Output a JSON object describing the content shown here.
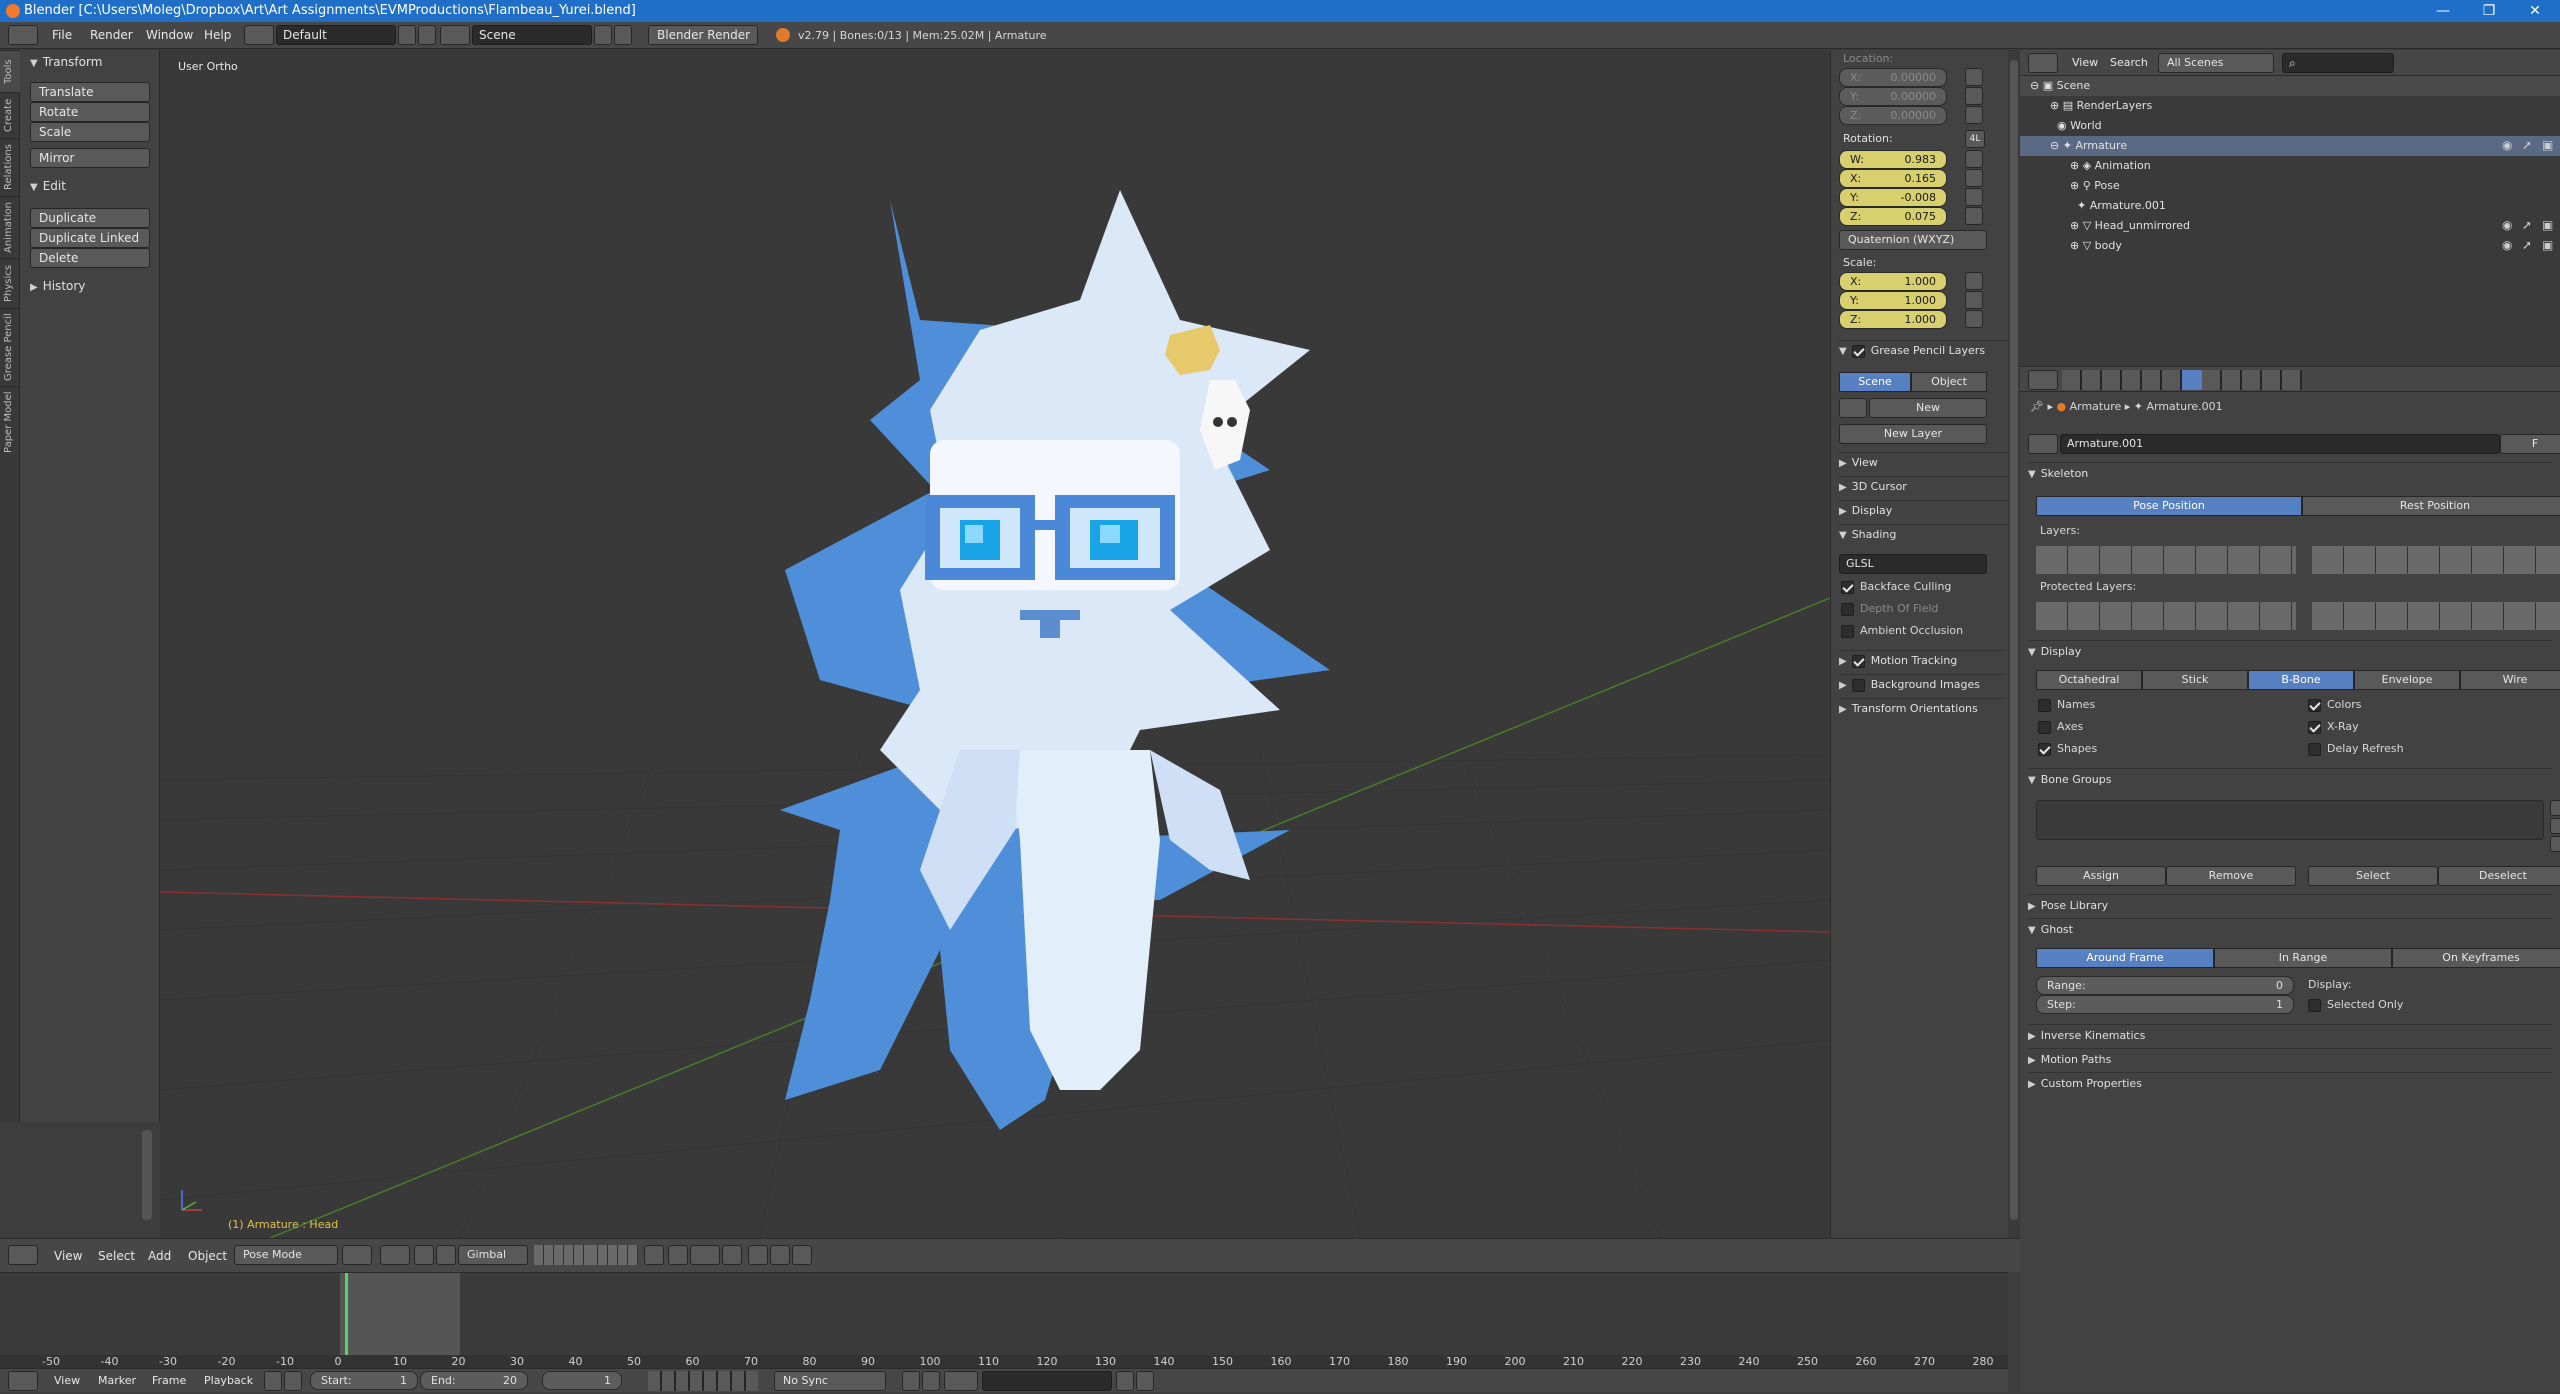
{
  "window": {
    "title": "Blender [C:\\Users\\Moleg\\Dropbox\\Art\\Art Assignments\\EVMProductions\\Flambeau_Yurei.blend]",
    "controls": [
      "—",
      "❐",
      "✕"
    ]
  },
  "infobar": {
    "menus": [
      "File",
      "Render",
      "Window",
      "Help"
    ],
    "layout": "Default",
    "scene": "Scene",
    "engine": "Blender Render",
    "stats": "v2.79 | Bones:0/13 | Mem:25.02M | Armature"
  },
  "toolshelf": {
    "tabs": [
      "Tools",
      "Create",
      "Relations",
      "Animation",
      "Physics",
      "Grease Pencil",
      "Paper Model"
    ],
    "transform_title": "Transform",
    "transform": [
      "Translate",
      "Rotate",
      "Scale"
    ],
    "mirror": "Mirror",
    "edit_title": "Edit",
    "edit": [
      "Duplicate",
      "Duplicate Linked",
      "Delete"
    ],
    "history_title": "History"
  },
  "viewport": {
    "view_label": "User Ortho",
    "status": "(1) Armature : Head"
  },
  "npanel": {
    "location_label": "Location:",
    "location": [
      "X:",
      "0.00000",
      "Y:",
      "0.00000",
      "Z:",
      "0.00000"
    ],
    "rotation_label": "Rotation:",
    "rotation_mode_btn": "4L",
    "rotation": [
      "W:",
      "0.983",
      "X:",
      "0.165",
      "Y:",
      "-0.008",
      "Z:",
      "0.075"
    ],
    "rotation_mode": "Quaternion (WXYZ)",
    "scale_label": "Scale:",
    "scale": [
      "X:",
      "1.000",
      "Y:",
      "1.000",
      "Z:",
      "1.000"
    ],
    "grease_pencil": "Grease Pencil Layers",
    "gp_tabs": [
      "Scene",
      "Object"
    ],
    "gp_new": "New",
    "new_layer": "New Layer",
    "panels": [
      "View",
      "3D Cursor",
      "Display",
      "Shading"
    ],
    "shading_mode": "GLSL",
    "shading_opts": [
      "Backface Culling",
      "Depth Of Field",
      "Ambient Occlusion"
    ],
    "motion_tracking": "Motion Tracking",
    "bg_images": "Background Images",
    "transform_orient": "Transform Orientations"
  },
  "vpheader": {
    "menus": [
      "View",
      "Select",
      "Add",
      "Object"
    ],
    "mode": "Pose Mode",
    "orientation": "Gimbal"
  },
  "timeline": {
    "ticks": [
      "-50",
      "-40",
      "-30",
      "-20",
      "-10",
      "0",
      "10",
      "20",
      "30",
      "40",
      "50",
      "60",
      "70",
      "80",
      "90",
      "100",
      "110",
      "120",
      "130",
      "140",
      "150",
      "160",
      "170",
      "180",
      "190",
      "200",
      "210",
      "220",
      "230",
      "240",
      "250",
      "260",
      "270",
      "280"
    ],
    "menus": [
      "View",
      "Marker",
      "Frame",
      "Playback"
    ],
    "start": "Start:",
    "start_val": "1",
    "end": "End:",
    "end_val": "20",
    "current": "1",
    "sync": "No Sync"
  },
  "outliner": {
    "menus": [
      "View",
      "Search"
    ],
    "filter": "All Scenes",
    "rows": [
      "Scene",
      "RenderLayers",
      "World",
      "Armature",
      "Animation",
      "Pose",
      "Armature.001",
      "Head_unmirrored",
      "body"
    ]
  },
  "props": {
    "breadcrumb": [
      "Armature",
      "Armature.001"
    ],
    "datablock": "Armature.001",
    "fake_user": "F",
    "skeleton": "Skeleton",
    "pose_position": "Pose Position",
    "rest_position": "Rest Position",
    "layers": "Layers:",
    "protected_layers": "Protected Layers:",
    "display": "Display",
    "display_modes": [
      "Octahedral",
      "Stick",
      "B-Bone",
      "Envelope",
      "Wire"
    ],
    "display_opts": [
      "Names",
      "Colors",
      "Axes",
      "X-Ray",
      "Shapes",
      "Delay Refresh"
    ],
    "bone_groups": "Bone Groups",
    "bg_buttons": [
      "Assign",
      "Remove",
      "Select",
      "Deselect"
    ],
    "pose_library": "Pose Library",
    "ghost": "Ghost",
    "ghost_modes": [
      "Around Frame",
      "In Range",
      "On Keyframes"
    ],
    "range": "Range:",
    "range_val": "0",
    "step": "Step:",
    "step_val": "1",
    "ghost_display": "Display:",
    "selected_only": "Selected Only",
    "ik": "Inverse Kinematics",
    "motion_paths": "Motion Paths",
    "custom_props": "Custom Properties"
  },
  "colors": {
    "accent": "#5680c2",
    "titlebar": "#1f6fc9",
    "numfield": "#d8cf6e",
    "grid_red": "#8a3030",
    "grid_green": "#4a7a2a"
  }
}
